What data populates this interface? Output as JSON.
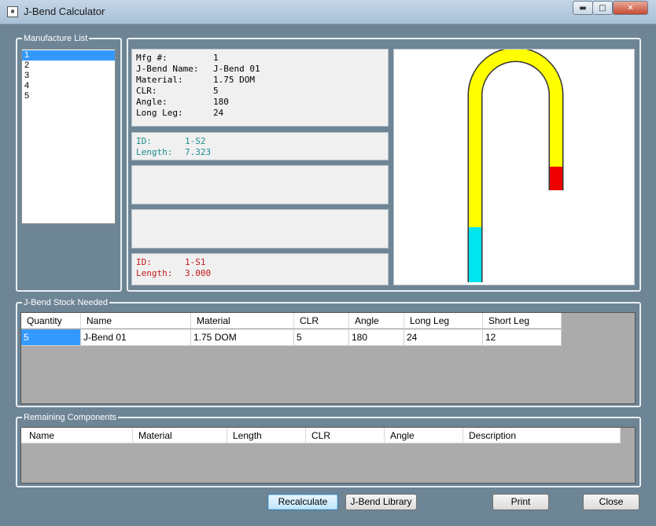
{
  "window": {
    "title": "J-Bend Calculator",
    "app_icon": "calculator-icon",
    "minimize_glyph": "▬",
    "maximize_glyph": "□",
    "close_glyph": "✕"
  },
  "manufacture_list": {
    "legend": "Manufacture List",
    "items": [
      "1",
      "2",
      "3",
      "4",
      "5"
    ],
    "selected_index": 0
  },
  "details": {
    "rows": [
      {
        "label": "Mfg #:",
        "value": "1"
      },
      {
        "label": "J-Bend Name:",
        "value": "J-Bend 01"
      },
      {
        "label": "Material:",
        "value": "1.75 DOM"
      },
      {
        "label": "CLR:",
        "value": "5"
      },
      {
        "label": "Angle:",
        "value": "180"
      },
      {
        "label": "Long Leg:",
        "value": "24"
      }
    ]
  },
  "segments": {
    "s2": {
      "id_label": "ID:",
      "id_value": "1-S2",
      "length_label": "Length:",
      "length_value": "7.323",
      "color": "#1a8c8c"
    },
    "s1": {
      "id_label": "ID:",
      "id_value": "1-S1",
      "length_label": "Length:",
      "length_value": "3.000",
      "color": "#c01818"
    }
  },
  "preview": {
    "tube_color": "#ffff00",
    "long_leg_segment_color": "#00e5ee",
    "short_leg_segment_color": "#ee0000"
  },
  "stock_needed": {
    "legend": "J-Bend Stock Needed",
    "columns": [
      "Quantity",
      "Name",
      "Material",
      "CLR",
      "Angle",
      "Long Leg",
      "Short Leg"
    ],
    "rows": [
      [
        "5",
        "J-Bend 01",
        "1.75 DOM",
        "5",
        "180",
        "24",
        "12"
      ]
    ]
  },
  "remaining": {
    "legend": "Remaining Components",
    "columns": [
      "Name",
      "Material",
      "Length",
      "CLR",
      "Angle",
      "Description"
    ]
  },
  "buttons": {
    "recalculate": "Recalculate",
    "library": "J-Bend Library",
    "print": "Print",
    "close": "Close"
  }
}
